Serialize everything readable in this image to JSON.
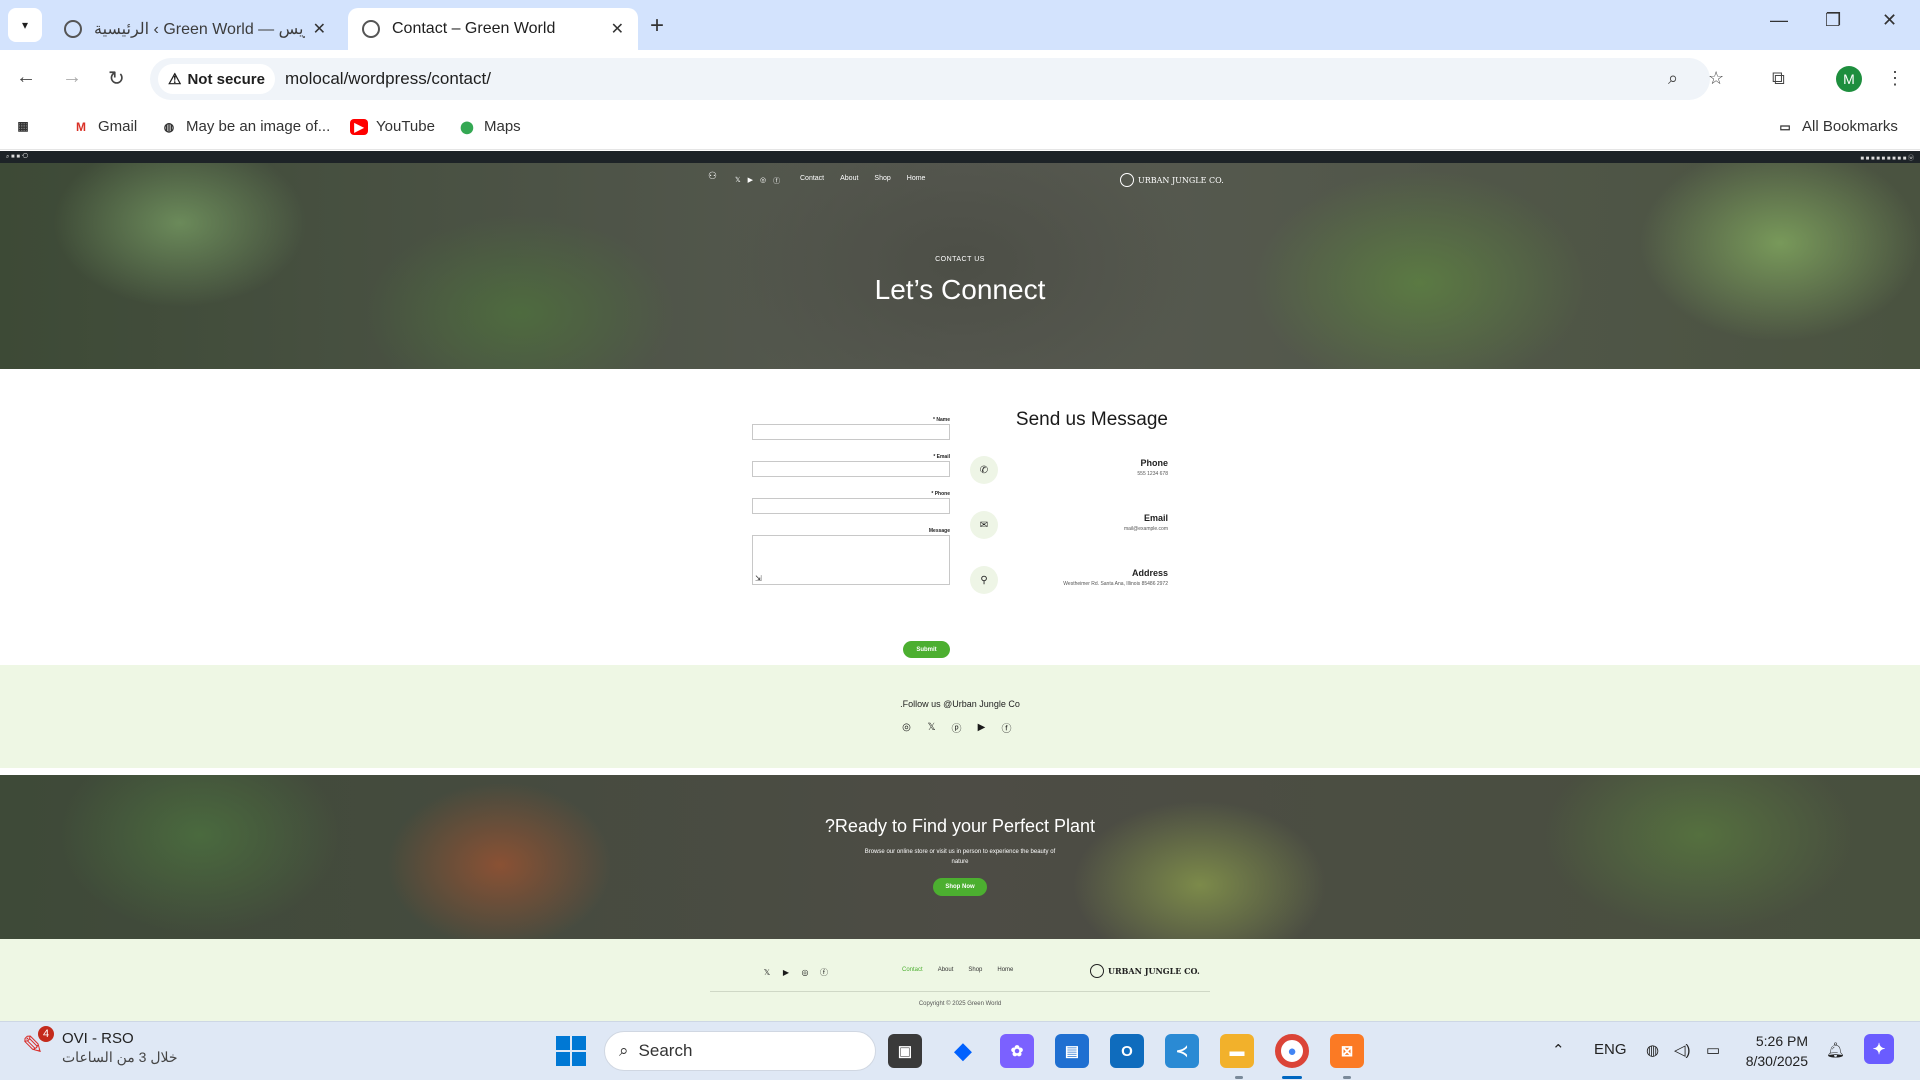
{
  "browser": {
    "tabs": [
      {
        "title": "الرئيسية ‹ Green World — ووردبريس",
        "active": false
      },
      {
        "title": "Contact – Green World",
        "active": true
      }
    ],
    "security_label": "Not secure",
    "url": "molocal/wordpress/contact/",
    "profile_initial": "M",
    "bookmarks": [
      "Gmail",
      "May be an image of...",
      "YouTube",
      "Maps"
    ],
    "all_bookmarks": "All Bookmarks"
  },
  "site": {
    "nav": [
      "Contact",
      "About",
      "Shop",
      "Home"
    ],
    "logo": "URBAN JUNGLE CO.",
    "hero": {
      "eyebrow": "CONTACT US",
      "title": "Let’s Connect"
    },
    "form": {
      "labels": [
        "* Name",
        "* Email",
        "* Phone",
        "Message"
      ],
      "submit": "Submit"
    },
    "contact_info": {
      "title": "Send us Message",
      "items": [
        {
          "title": "Phone",
          "value": "555 1234 678",
          "icon": "phone-icon"
        },
        {
          "title": "Email",
          "value": "mail@example.com",
          "icon": "envelope-icon"
        },
        {
          "title": "Address",
          "value": "Westheimer Rd. Santa Ana, Illinois 85486 2972",
          "icon": "location-pin-icon"
        }
      ]
    },
    "follow": {
      "text": ".Follow us @Urban Jungle Co"
    },
    "cta": {
      "title": "?Ready to Find your Perfect Plant",
      "subtitle": "Browse our online store or visit us in person to experience the beauty of nature",
      "button": "Shop Now"
    },
    "footer": {
      "links": [
        "Contact",
        "About",
        "Shop",
        "Home"
      ],
      "logo": "URBAN JUNGLE CO.",
      "copyright": "Copyright © 2025 Green World"
    }
  },
  "taskbar": {
    "notification": {
      "title": "OVI - RSO",
      "subtitle": "خلال 3 من الساعات",
      "badge": "4"
    },
    "search_placeholder": "Search",
    "language": "ENG",
    "time": "5:26 PM",
    "date": "8/30/2025"
  }
}
